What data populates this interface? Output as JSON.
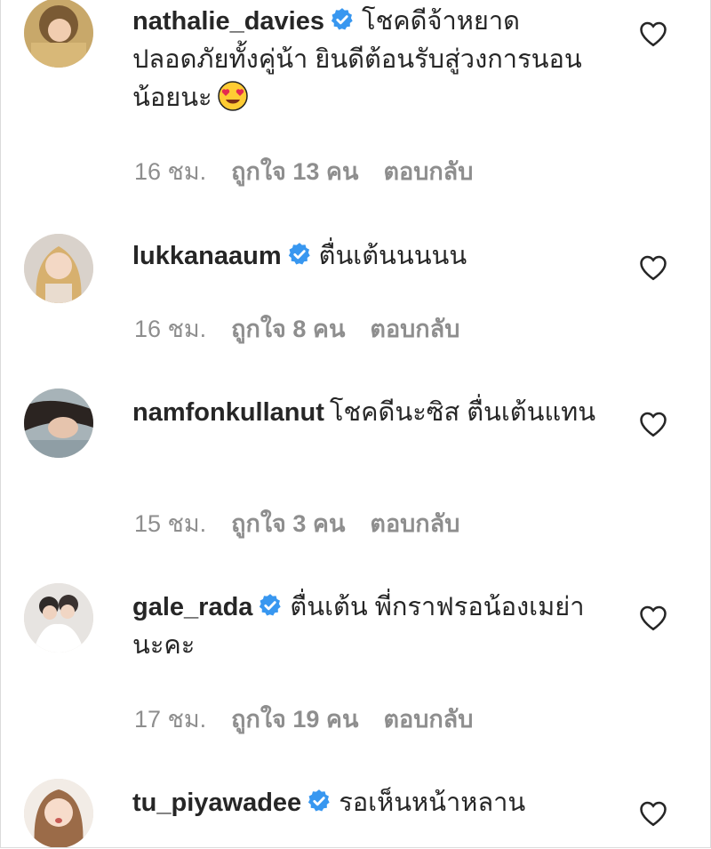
{
  "colors": {
    "text": "#262626",
    "muted": "#8e8e8e",
    "verified": "#3897f0"
  },
  "comments": [
    {
      "username": "nathalie_davies",
      "verified": true,
      "text": "โชคดีจ้าหยาด ปลอดภัยทั้งคู่น้า ยินดีต้อนรับสู่วงการนอนน้อยนะ",
      "emoji": "heart-eyes-emoji",
      "time": "16 ชม.",
      "likes": "ถูกใจ 13 คน",
      "reply": "ตอบกลับ"
    },
    {
      "username": "lukkanaaum",
      "verified": true,
      "text": "ตื่นเต้นนนนน",
      "time": "16 ชม.",
      "likes": "ถูกใจ 8 คน",
      "reply": "ตอบกลับ"
    },
    {
      "username": "namfonkullanut",
      "verified": false,
      "text": "โชคดีนะซิส ตื่นเต้นแทน",
      "time": "15 ชม.",
      "likes": "ถูกใจ 3 คน",
      "reply": "ตอบกลับ"
    },
    {
      "username": "gale_rada",
      "verified": true,
      "text": "ตื่นเต้น พี่กราฟรอน้องเมย่านะคะ",
      "time": "17 ชม.",
      "likes": "ถูกใจ 19 คน",
      "reply": "ตอบกลับ"
    },
    {
      "username": "tu_piyawadee",
      "verified": true,
      "text": "รอเห็นหน้าหลาน"
    }
  ]
}
